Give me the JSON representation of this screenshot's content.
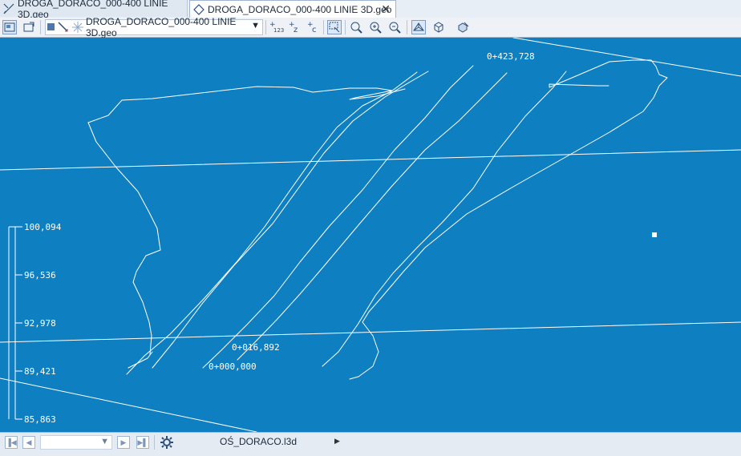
{
  "tabs": [
    {
      "label": "DROGA_DORACO_000-400 LINIE 3D.geo",
      "icon": "drawing-icon"
    },
    {
      "label": "DROGA_DORACO_000-400 LINIE 3D.geo",
      "icon": "geo-file-icon",
      "close": "✕"
    }
  ],
  "toolbar": {
    "geo_select_value": "DROGA_DORACO_000-400 LINIE 3D.geo",
    "buttons": [
      "layers-icon",
      "properties-icon",
      "color-square-icon",
      "pen-icon",
      "snap-icon",
      "numbering-123-icon",
      "plus-z-icon",
      "plus-c-icon",
      "select-frame-icon",
      "zoom-window-icon",
      "zoom-in-icon",
      "zoom-out-icon",
      "view-3d-icon",
      "cube-icon",
      "render-icon"
    ]
  },
  "viewport": {
    "station_labels": [
      "0+423,728",
      "0+016,892",
      "0+000,000"
    ],
    "elevation_labels": [
      "100,094",
      "96,536",
      "92,978",
      "89,421",
      "85,863"
    ],
    "background": "#0e7fc0",
    "line_color": "#ffffff"
  },
  "statusbar": {
    "filename": "OŚ_DORACO.l3d",
    "nav_buttons": [
      "first-icon",
      "prev-icon",
      "next-icon",
      "last-icon"
    ],
    "settings_icon": "gear-icon"
  }
}
